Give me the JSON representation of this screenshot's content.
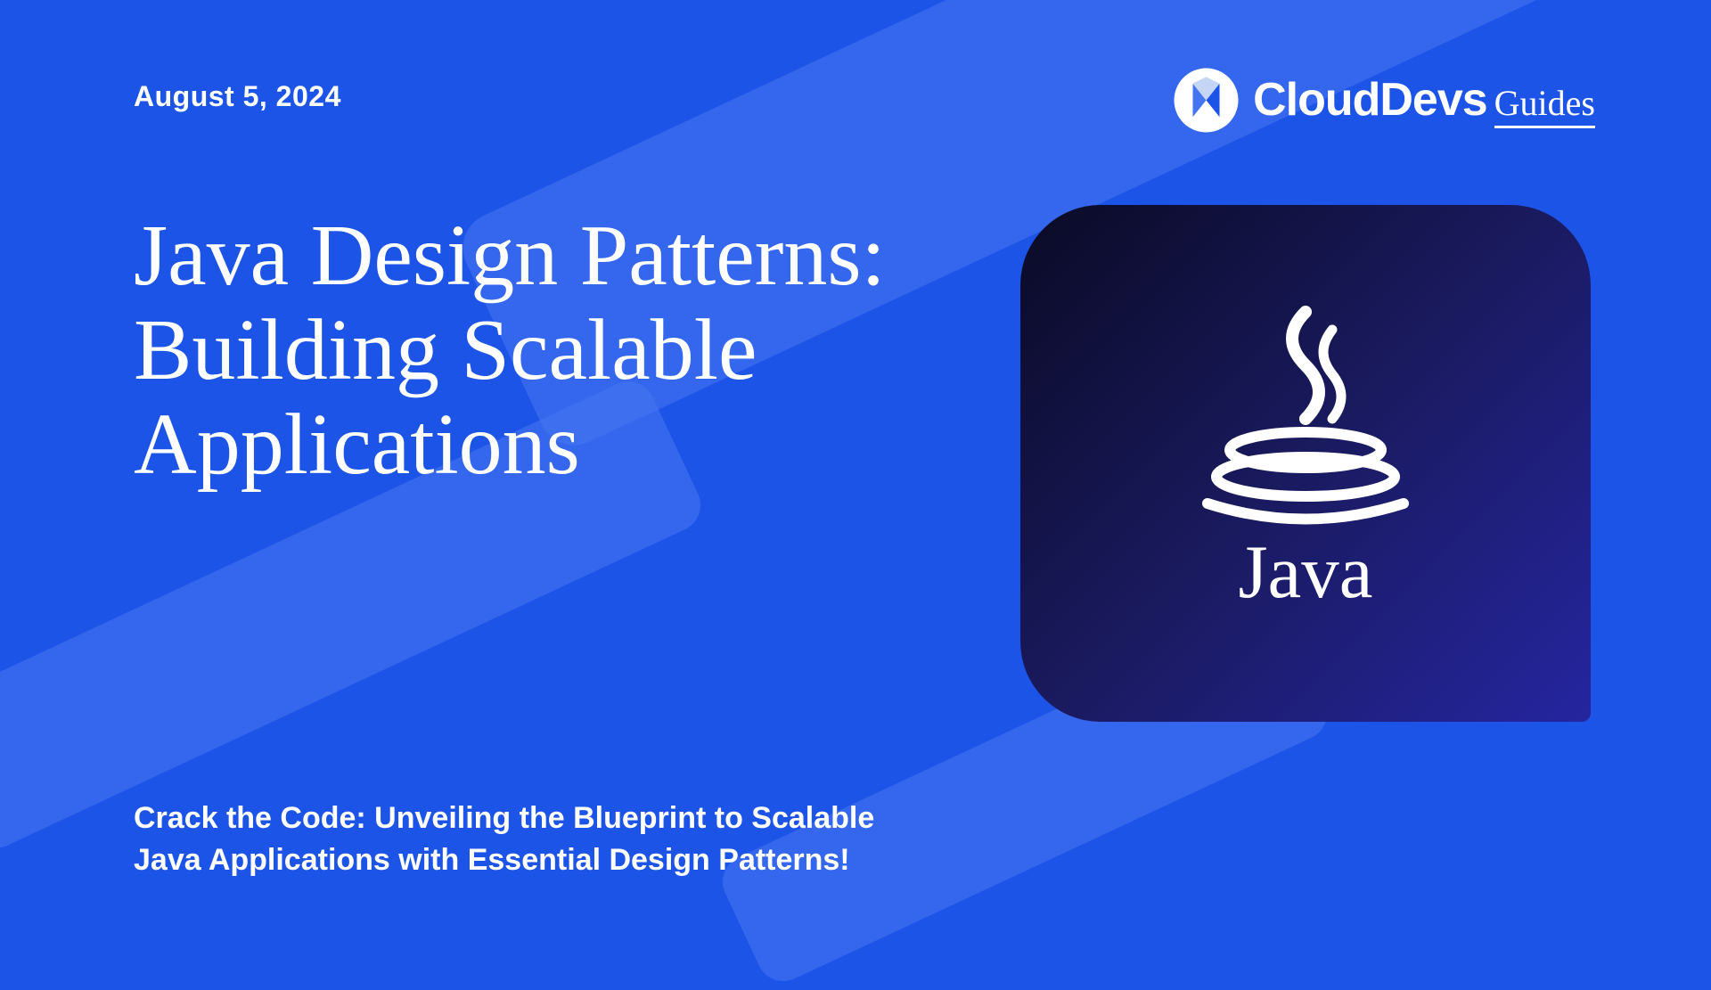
{
  "date": "August 5, 2024",
  "logo": {
    "main": "CloudDevs",
    "sub": "Guides"
  },
  "title": "Java Design Patterns: Building Scalable Applications",
  "subtitle": "Crack the Code: Unveiling the Blueprint to Scalable Java Applications with Essential Design Patterns!",
  "java_logo_text": "Java"
}
